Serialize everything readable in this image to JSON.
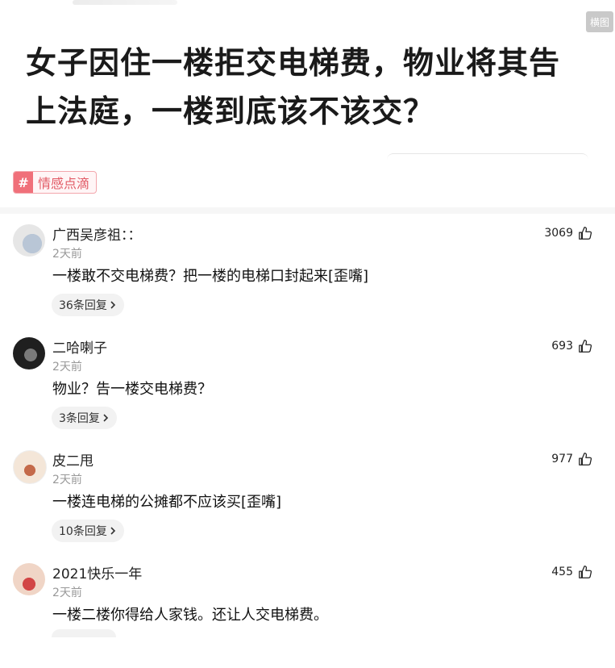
{
  "header": {
    "badge_label": "横图",
    "title": "女子因住一楼拒交电梯费，物业将其告上法庭，一楼到底该不该交？"
  },
  "tag": {
    "icon_glyph": "#",
    "label": "情感点滴"
  },
  "comments": [
    {
      "user": "广西吴彦祖：：",
      "time": "2天前",
      "text": "一楼敢不交电梯费？把一楼的电梯口封起来[歪嘴]",
      "likes": "3069",
      "replies": "36条回复",
      "avatar_colors": [
        "#e6e6e6",
        "#b9c6d6"
      ]
    },
    {
      "user": "二哈喇子",
      "time": "2天前",
      "text": "物业？告一楼交电梯费？",
      "likes": "693",
      "replies": "3条回复",
      "avatar_colors": [
        "#1f1f1f",
        "#7a7a7a"
      ]
    },
    {
      "user": "皮二甩",
      "time": "2天前",
      "text": "一楼连电梯的公摊都不应该买[歪嘴]",
      "likes": "977",
      "replies": "10条回复",
      "avatar_colors": [
        "#f4e6d8",
        "#c46a4a"
      ]
    },
    {
      "user": "2021快乐一年",
      "time": "2天前",
      "text": "一楼二楼你得给人家钱。还让人交电梯费。",
      "likes": "455",
      "replies": "",
      "avatar_colors": [
        "#f0d5c6",
        "#d24545"
      ]
    }
  ],
  "icons": {
    "like": "thumbs-up-icon",
    "chevron": "chevron-right-icon",
    "tag": "hash-icon"
  }
}
